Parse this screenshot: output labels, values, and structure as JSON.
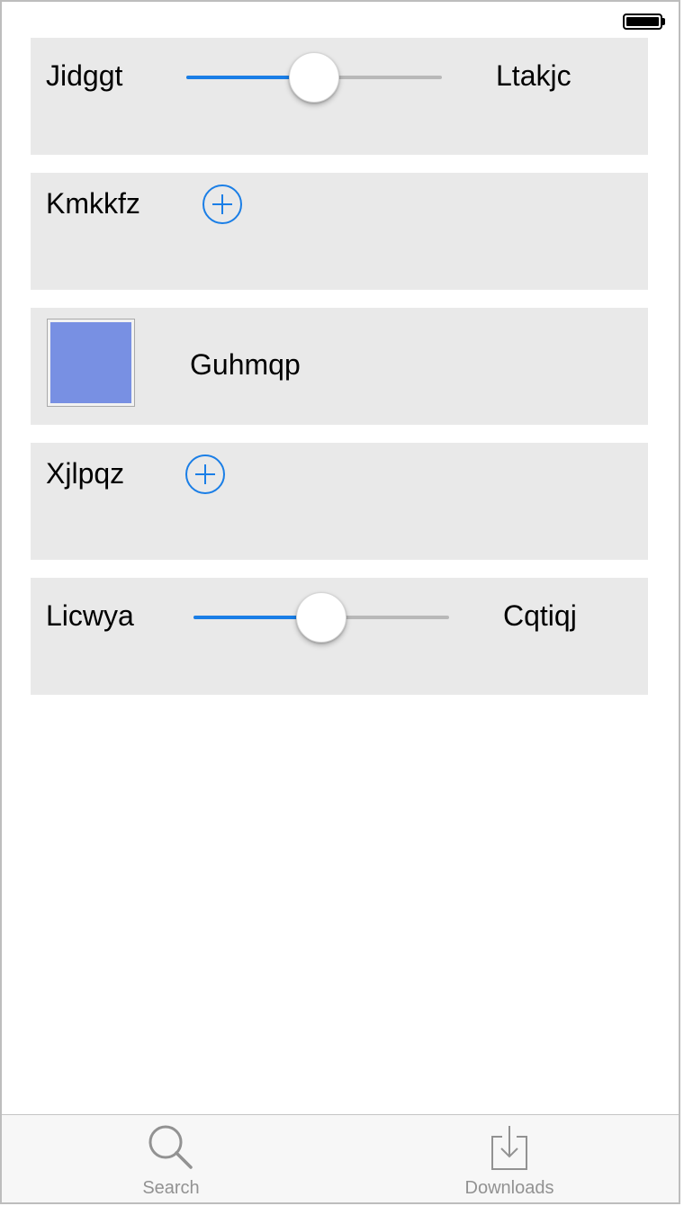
{
  "colors": {
    "accent": "#1a7ee6",
    "row_background": "#e9e9e9",
    "swatch_color": "#7890e3",
    "tab_inactive": "#929292"
  },
  "rows": [
    {
      "type": "slider",
      "label_left": "Jidggt",
      "label_right": "Ltakjc",
      "value": 0.5
    },
    {
      "type": "add",
      "label": "Kmkkfz",
      "icon": "plus-circle-icon"
    },
    {
      "type": "color",
      "label": "Guhmqp"
    },
    {
      "type": "add",
      "label": "Xjlpqz",
      "icon": "plus-circle-icon"
    },
    {
      "type": "slider",
      "label_left": "Licwya",
      "label_right": "Cqtiqj",
      "value": 0.5
    }
  ],
  "tab_bar": {
    "items": [
      {
        "label": "Search",
        "icon": "search-icon"
      },
      {
        "label": "Downloads",
        "icon": "downloads-icon"
      }
    ]
  }
}
